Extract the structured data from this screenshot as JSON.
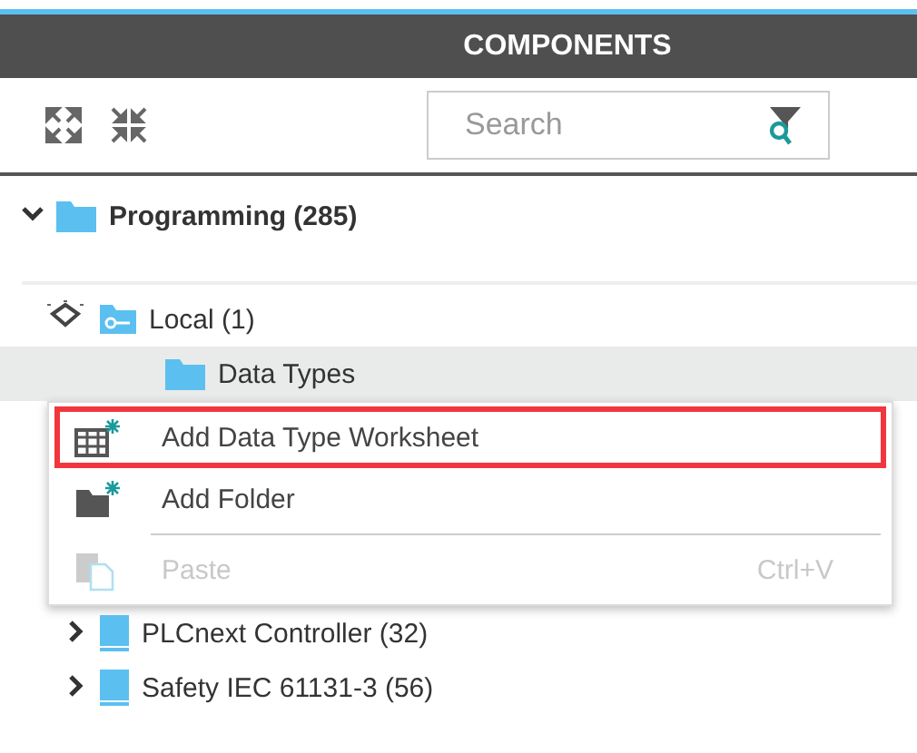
{
  "panel": {
    "title": "COMPONENTS"
  },
  "toolbar": {
    "search": {
      "placeholder": "Search"
    }
  },
  "tree": [
    {
      "label": "Programming (285)",
      "kind": "folder",
      "expanded": true,
      "selected": false,
      "children": [
        {
          "label": "Local (1)",
          "kind": "library",
          "expanded": true,
          "selected": false,
          "children": [
            {
              "label": "Data Types",
              "kind": "folder",
              "selected": true
            }
          ]
        }
      ]
    }
  ],
  "context_menu": [
    {
      "label": "Add Data Type Worksheet",
      "kind": "worksheet",
      "highlighted": true,
      "disabled": false
    },
    {
      "label": "Add Folder",
      "kind": "folder",
      "highlighted": false,
      "disabled": false
    },
    {
      "label": "Paste",
      "kind": "paste",
      "highlighted": false,
      "disabled": true,
      "shortcut": "Ctrl+V"
    }
  ],
  "tree_below": [
    {
      "label": "PLCnext Controller (32)",
      "kind": "book",
      "expanded": false
    },
    {
      "label": "Safety IEC 61131-3 (56)",
      "kind": "book",
      "expanded": false
    }
  ]
}
